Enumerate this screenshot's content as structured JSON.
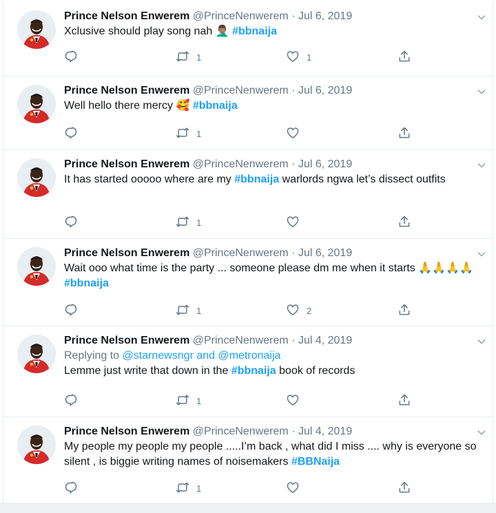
{
  "tweets": [
    {
      "name": "Prince Nelson Enwerem",
      "handle": "@PrinceNenwerem",
      "dot": "·",
      "date": "Jul 6, 2019",
      "reply_prefix": "",
      "reply_users": "",
      "text_before": "Xclusive should play song nah",
      "emoji": "🤦🏽‍♂️",
      "hashtag": "#bbnaija",
      "text_after": "",
      "retweets": "1",
      "likes": "1"
    },
    {
      "name": "Prince Nelson Enwerem",
      "handle": "@PrinceNenwerem",
      "dot": "·",
      "date": "Jul 6, 2019",
      "reply_prefix": "",
      "reply_users": "",
      "text_before": "Well hello there mercy",
      "emoji": "🥰",
      "hashtag": "#bbnaija",
      "text_after": "",
      "retweets": "1",
      "likes": ""
    },
    {
      "name": "Prince Nelson Enwerem",
      "handle": "@PrinceNenwerem",
      "dot": "·",
      "date": "Jul 6, 2019",
      "reply_prefix": "",
      "reply_users": "",
      "text_before": "It has started ooooo where are my",
      "emoji": "",
      "hashtag": "#bbnaija",
      "text_after": "warlords ngwa let’s dissect outfits",
      "retweets": "1",
      "likes": ""
    },
    {
      "name": "Prince Nelson Enwerem",
      "handle": "@PrinceNenwerem",
      "dot": "·",
      "date": "Jul 6, 2019",
      "reply_prefix": "",
      "reply_users": "",
      "text_before": "Wait ooo what time is the party ... someone please dm me when it starts",
      "emoji": "🙏🙏🙏🙏",
      "hashtag": "#bbnaija",
      "text_after": "",
      "retweets": "1",
      "likes": "2"
    },
    {
      "name": "Prince Nelson Enwerem",
      "handle": "@PrinceNenwerem",
      "dot": "·",
      "date": "Jul 4, 2019",
      "reply_prefix": "Replying to",
      "reply_users": "@starnewsngr and @metronaija",
      "text_before": "Lemme just write that down in the",
      "emoji": "",
      "hashtag": "#bbnaija",
      "text_after": "book of records",
      "retweets": "1",
      "likes": ""
    },
    {
      "name": "Prince Nelson Enwerem",
      "handle": "@PrinceNenwerem",
      "dot": "·",
      "date": "Jul 4, 2019",
      "reply_prefix": "",
      "reply_users": "",
      "text_before": "My people my people my people .....I’m back , what did I miss .... why is everyone so silent , is biggie writing names of noisemakers",
      "emoji": "",
      "hashtag": "#BBNaija",
      "text_after": "",
      "retweets": "1",
      "likes": ""
    }
  ],
  "icons": {
    "reply": "reply-icon",
    "retweet": "retweet-icon",
    "like": "like-icon",
    "share": "share-icon",
    "caret": "chevron-down-icon"
  },
  "colors": {
    "link": "#1da1f2",
    "muted": "#657786",
    "text": "#14171a",
    "divider": "#e6ecf0"
  }
}
